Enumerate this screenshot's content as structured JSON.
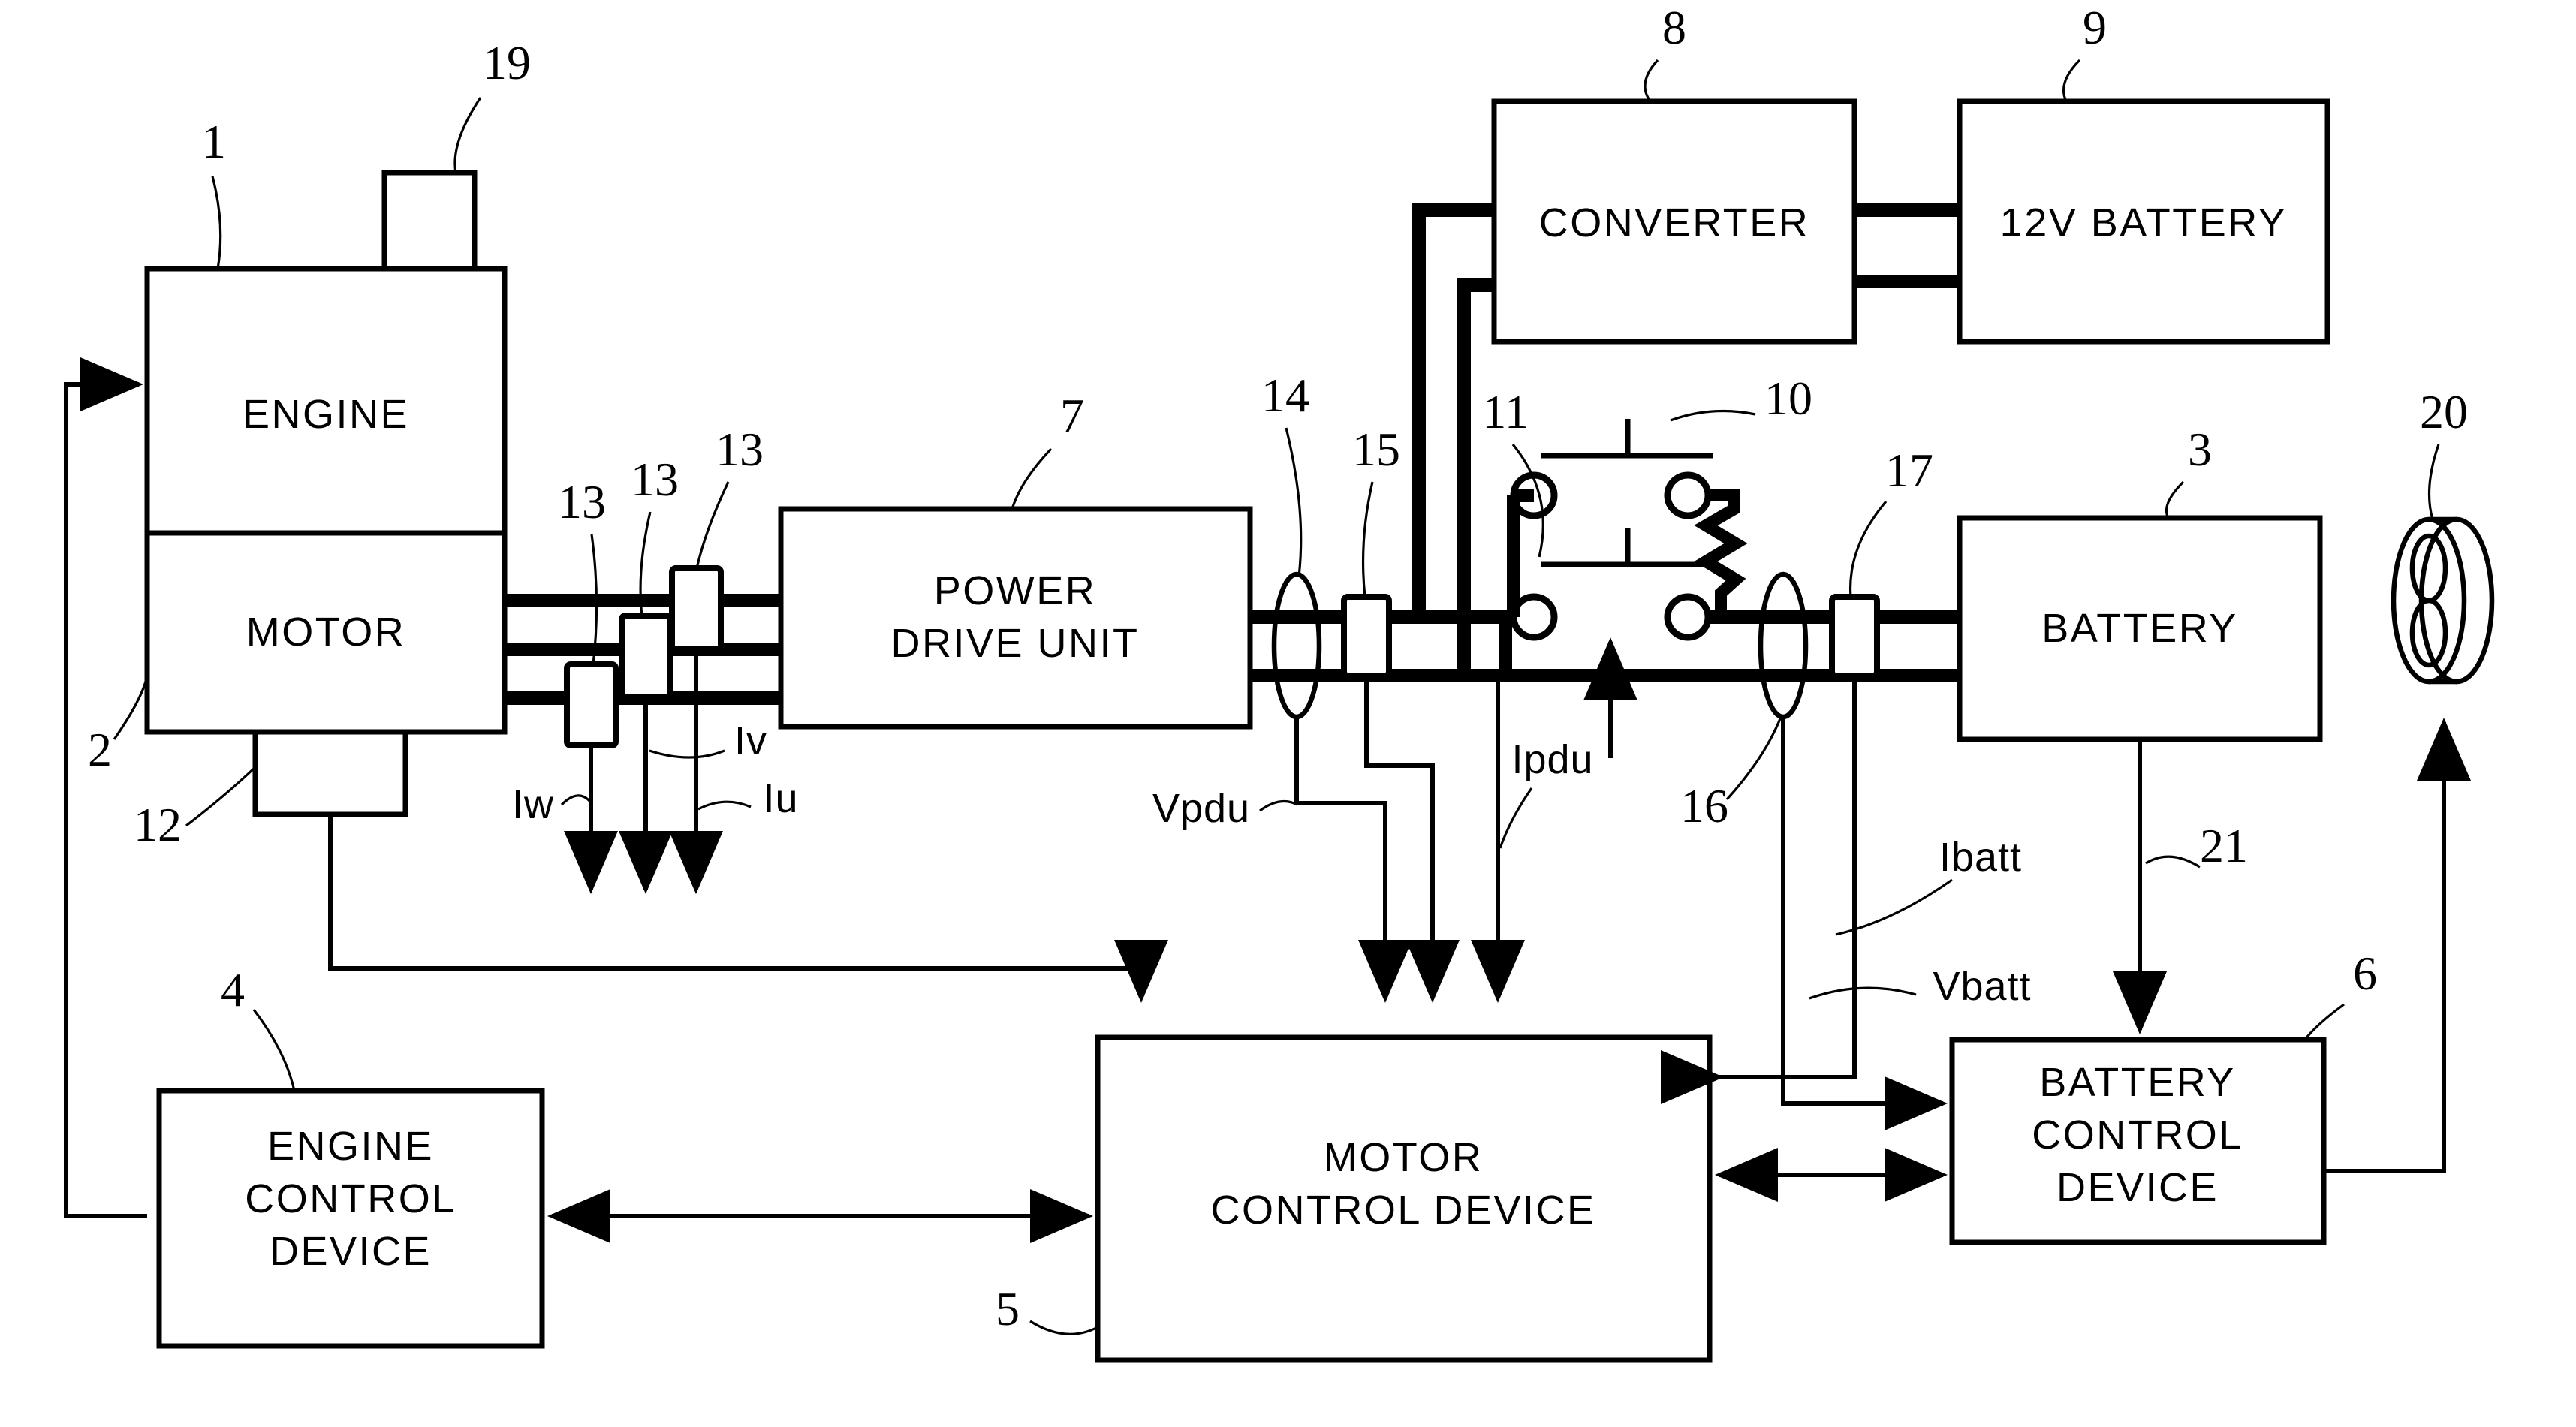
{
  "diagram": {
    "type": "hybrid-vehicle-power-system-block-diagram",
    "blocks": {
      "engine": "ENGINE",
      "motor": "MOTOR",
      "power_drive_unit_line1": "POWER",
      "power_drive_unit_line2": "DRIVE UNIT",
      "converter": "CONVERTER",
      "battery_12v": "12V BATTERY",
      "battery": "BATTERY",
      "engine_control_line1": "ENGINE",
      "engine_control_line2": "CONTROL",
      "engine_control_line3": "DEVICE",
      "motor_control_line1": "MOTOR",
      "motor_control_line2": "CONTROL DEVICE",
      "battery_control_line1": "BATTERY",
      "battery_control_line2": "CONTROL",
      "battery_control_line3": "DEVICE"
    },
    "reference_numerals": {
      "engine": "1",
      "motor": "2",
      "battery": "3",
      "engine_control_device": "4",
      "motor_control_device": "5",
      "battery_control_device": "6",
      "power_drive_unit": "7",
      "converter": "8",
      "battery_12v": "9",
      "contactor_assembly": "10",
      "contactor_main": "11",
      "resolver": "12",
      "current_sensor_w": "13",
      "current_sensor_v": "13",
      "current_sensor_u": "13",
      "pdu_voltage_sensor": "15",
      "pdu_current_sensor": "14",
      "battery_current_sensor": "16",
      "battery_voltage_sensor": "17",
      "engine_speed_sensor": "19",
      "cooling_fan": "20",
      "fan_signal": "21"
    },
    "signal_labels": {
      "iw": "Iw",
      "iv": "Iv",
      "iu": "Iu",
      "vpdu": "Vpdu",
      "ipdu": "Ipdu",
      "ibatt": "Ibatt",
      "vbatt": "Vbatt"
    },
    "colors": {
      "stroke": "#000000",
      "background": "#ffffff"
    }
  }
}
